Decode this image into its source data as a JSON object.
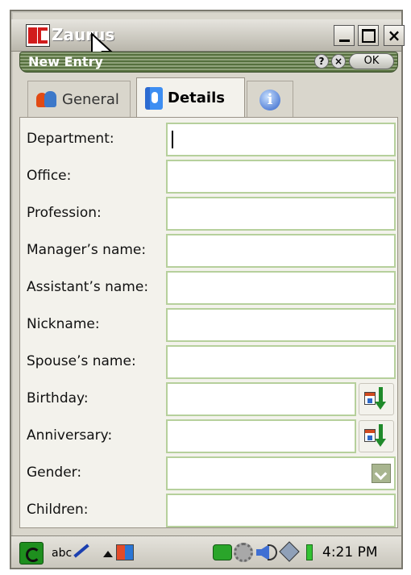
{
  "window": {
    "title": "Zaurus",
    "entry_title": "New Entry",
    "help_label": "?",
    "close_label": "×",
    "ok_label": "OK",
    "close_window_label": "×"
  },
  "tabs": [
    {
      "label": "General",
      "icon": "people-icon",
      "selected": false
    },
    {
      "label": "Details",
      "icon": "contact-card-icon",
      "selected": true
    },
    {
      "label": "",
      "icon": "info-icon",
      "selected": false
    }
  ],
  "info_glyph": "i",
  "form": {
    "fields": [
      {
        "label": "Department:",
        "value": ""
      },
      {
        "label": "Office:",
        "value": ""
      },
      {
        "label": "Profession:",
        "value": ""
      },
      {
        "label": "Manager’s name:",
        "value": ""
      },
      {
        "label": "Assistant’s name:",
        "value": ""
      },
      {
        "label": "Nickname:",
        "value": ""
      },
      {
        "label": "Spouse’s name:",
        "value": ""
      },
      {
        "label": "Birthday:",
        "value": ""
      },
      {
        "label": "Anniversary:",
        "value": ""
      },
      {
        "label": "Gender:",
        "value": ""
      },
      {
        "label": "Children:",
        "value": ""
      }
    ]
  },
  "taskbar": {
    "input_method": "abc",
    "clock": "4:21 PM"
  },
  "colors": {
    "field_border": "#b6d09c",
    "entry_bar": "#56703e",
    "panel_bg": "#f3f2ec"
  }
}
